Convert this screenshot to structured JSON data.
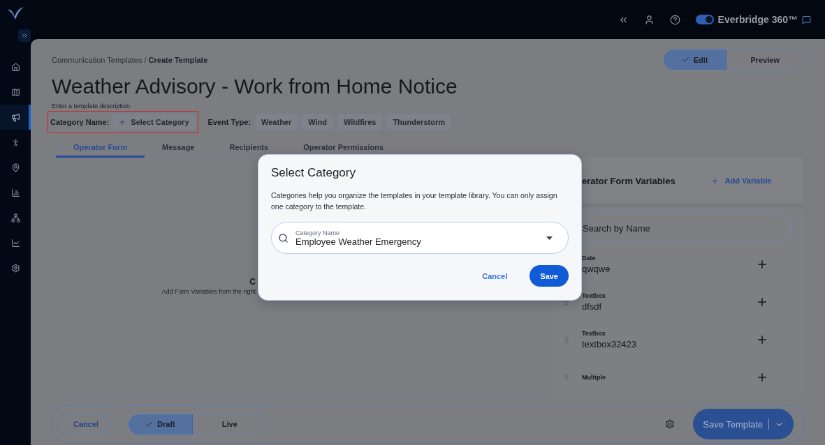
{
  "topbar": {
    "product_toggle": {
      "on": true
    },
    "product_name": "Everbridge 360™"
  },
  "sidebar": {
    "items": [
      {
        "selected": false
      },
      {
        "selected": false
      },
      {
        "selected": true
      },
      {
        "selected": false
      },
      {
        "selected": false
      },
      {
        "selected": false
      },
      {
        "selected": false
      },
      {
        "selected": false
      },
      {
        "selected": false
      }
    ]
  },
  "breadcrumb": {
    "parent": "Communication Templates",
    "separator": "/",
    "current": "Create Template"
  },
  "mode_toggle": [
    {
      "label": "Edit",
      "selected": true
    },
    {
      "label": "Preview",
      "selected": false
    }
  ],
  "title": "Weather Advisory - Work from Home Notice",
  "description_placeholder": "Enter a template description",
  "category": {
    "label": "Category Name:",
    "button": "Select Category",
    "highlighted": true
  },
  "event_type": {
    "label": "Event Type:",
    "tags": [
      "Weather",
      "Wind",
      "Wildfires",
      "Thunderstorm"
    ]
  },
  "tabs": [
    {
      "label": "Operator Form",
      "selected": true
    },
    {
      "label": "Message",
      "selected": false
    },
    {
      "label": "Recipients",
      "selected": false
    },
    {
      "label": "Operator Permissions",
      "selected": false
    }
  ],
  "form_area": {
    "heading": "C",
    "hint": "Add Form Variables from the right"
  },
  "variables_panel": {
    "title": "erator Form Variables",
    "add": "Add Variable",
    "search_placeholder": "Search by Name",
    "items": [
      {
        "type": "Date",
        "name": "qwqwe"
      },
      {
        "type": "Textbox",
        "name": "dfsdf"
      },
      {
        "type": "Textbox",
        "name": "textbox32423"
      },
      {
        "type": "Multiple"
      }
    ]
  },
  "footer": {
    "cancel": "Cancel",
    "status_toggle": [
      {
        "label": "Draft",
        "selected": true
      },
      {
        "label": "Live",
        "selected": false
      }
    ],
    "save": "Save Template"
  },
  "dialog": {
    "title": "Select Category",
    "text": "Categories help you organize the templates in your template library. You can only assign one category to the template.",
    "field_label": "Category Name",
    "field_value": "Employee Weather Emergency",
    "cancel": "Cancel",
    "save": "Save"
  }
}
